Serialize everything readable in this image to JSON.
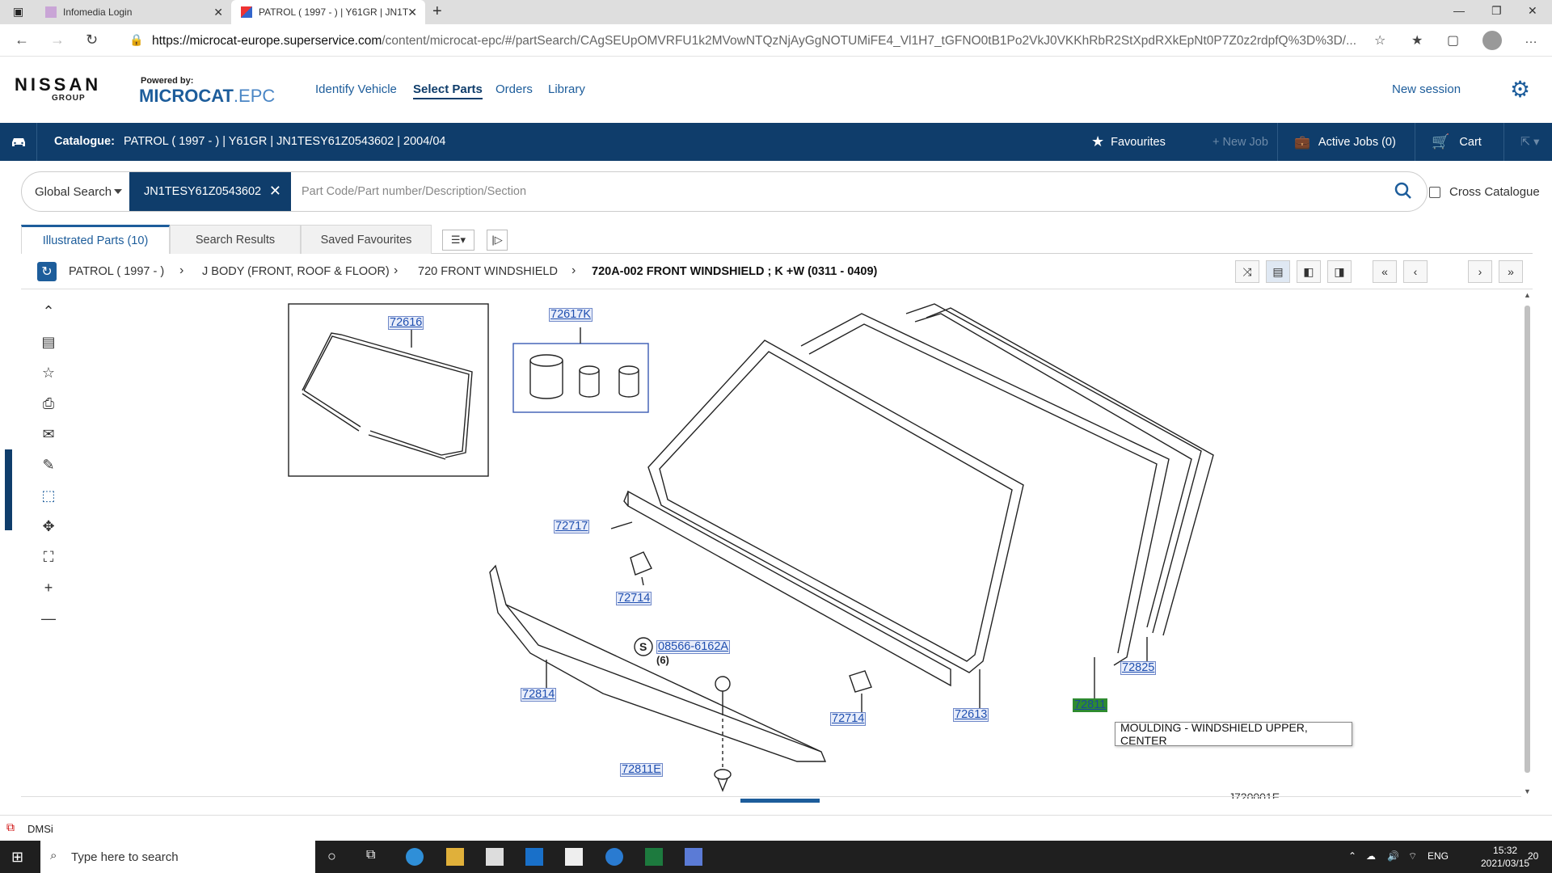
{
  "browser": {
    "tabs": [
      {
        "title": "Infomedia Login"
      },
      {
        "title": "PATROL ( 1997 - ) | Y61GR | JN1T"
      }
    ],
    "url_host": "https://microcat-europe.superservice.com",
    "url_rest": "/content/microcat-epc/#/partSearch/CAgSEUpOMVRFU1k2MVowNTQzNjAyGgNOTUMiFE4_Vl1H7_tGFNO0tB1Po2VkJ0VKKhRbR2StXpdRXkEpNt0P7Z0z2rdpfQ%3D%3D/..."
  },
  "header": {
    "brand": "NISSAN",
    "brand_sub": "GROUP",
    "powered_by": "Powered by:",
    "product_a": "MICROCAT",
    "product_b": ".EPC",
    "nav": [
      "Identify Vehicle",
      "Select Parts",
      "Orders",
      "Library"
    ],
    "new_session": "New session"
  },
  "catalogue_bar": {
    "label": "Catalogue:",
    "value": "PATROL ( 1997 - )  |  Y61GR  |  JN1TESY61Z0543602  |  2004/04",
    "favourites": "Favourites",
    "new_job": "+ New Job",
    "active_jobs": "Active Jobs (0)",
    "cart": "Cart"
  },
  "search": {
    "scope": "Global Search",
    "chip": "JN1TESY61Z0543602",
    "placeholder": "Part Code/Part number/Description/Section",
    "cross_catalogue": "Cross Catalogue"
  },
  "part_tabs": [
    "Illustrated Parts (10)",
    "Search Results",
    "Saved Favourites"
  ],
  "breadcrumb": [
    "PATROL ( 1997 - )",
    "J BODY (FRONT, ROOF & FLOOR)",
    "720 FRONT WINDSHIELD",
    "720A-002 FRONT WINDSHIELD ; K +W (0311 - 0409)"
  ],
  "diagram": {
    "labels": {
      "p72616": "72616",
      "p72617K": "72617K",
      "p72717": "72717",
      "p72714a": "72714",
      "p08566": "08566-6162A",
      "qty6": "(6)",
      "s_mark": "S",
      "p72814": "72814",
      "p72714b": "72714",
      "p72613": "72613",
      "p72811": "72811",
      "p72825": "72825",
      "p72811E": "72811E"
    },
    "tooltip": "MOULDING - WINDSHIELD UPPER, CENTER",
    "sheet_id": "J720001E"
  },
  "status": {
    "app": "DMSi"
  },
  "taskbar": {
    "search_placeholder": "Type here to search",
    "lang": "ENG",
    "time": "15:32",
    "date": "2021/03/15",
    "notifications": "20"
  }
}
